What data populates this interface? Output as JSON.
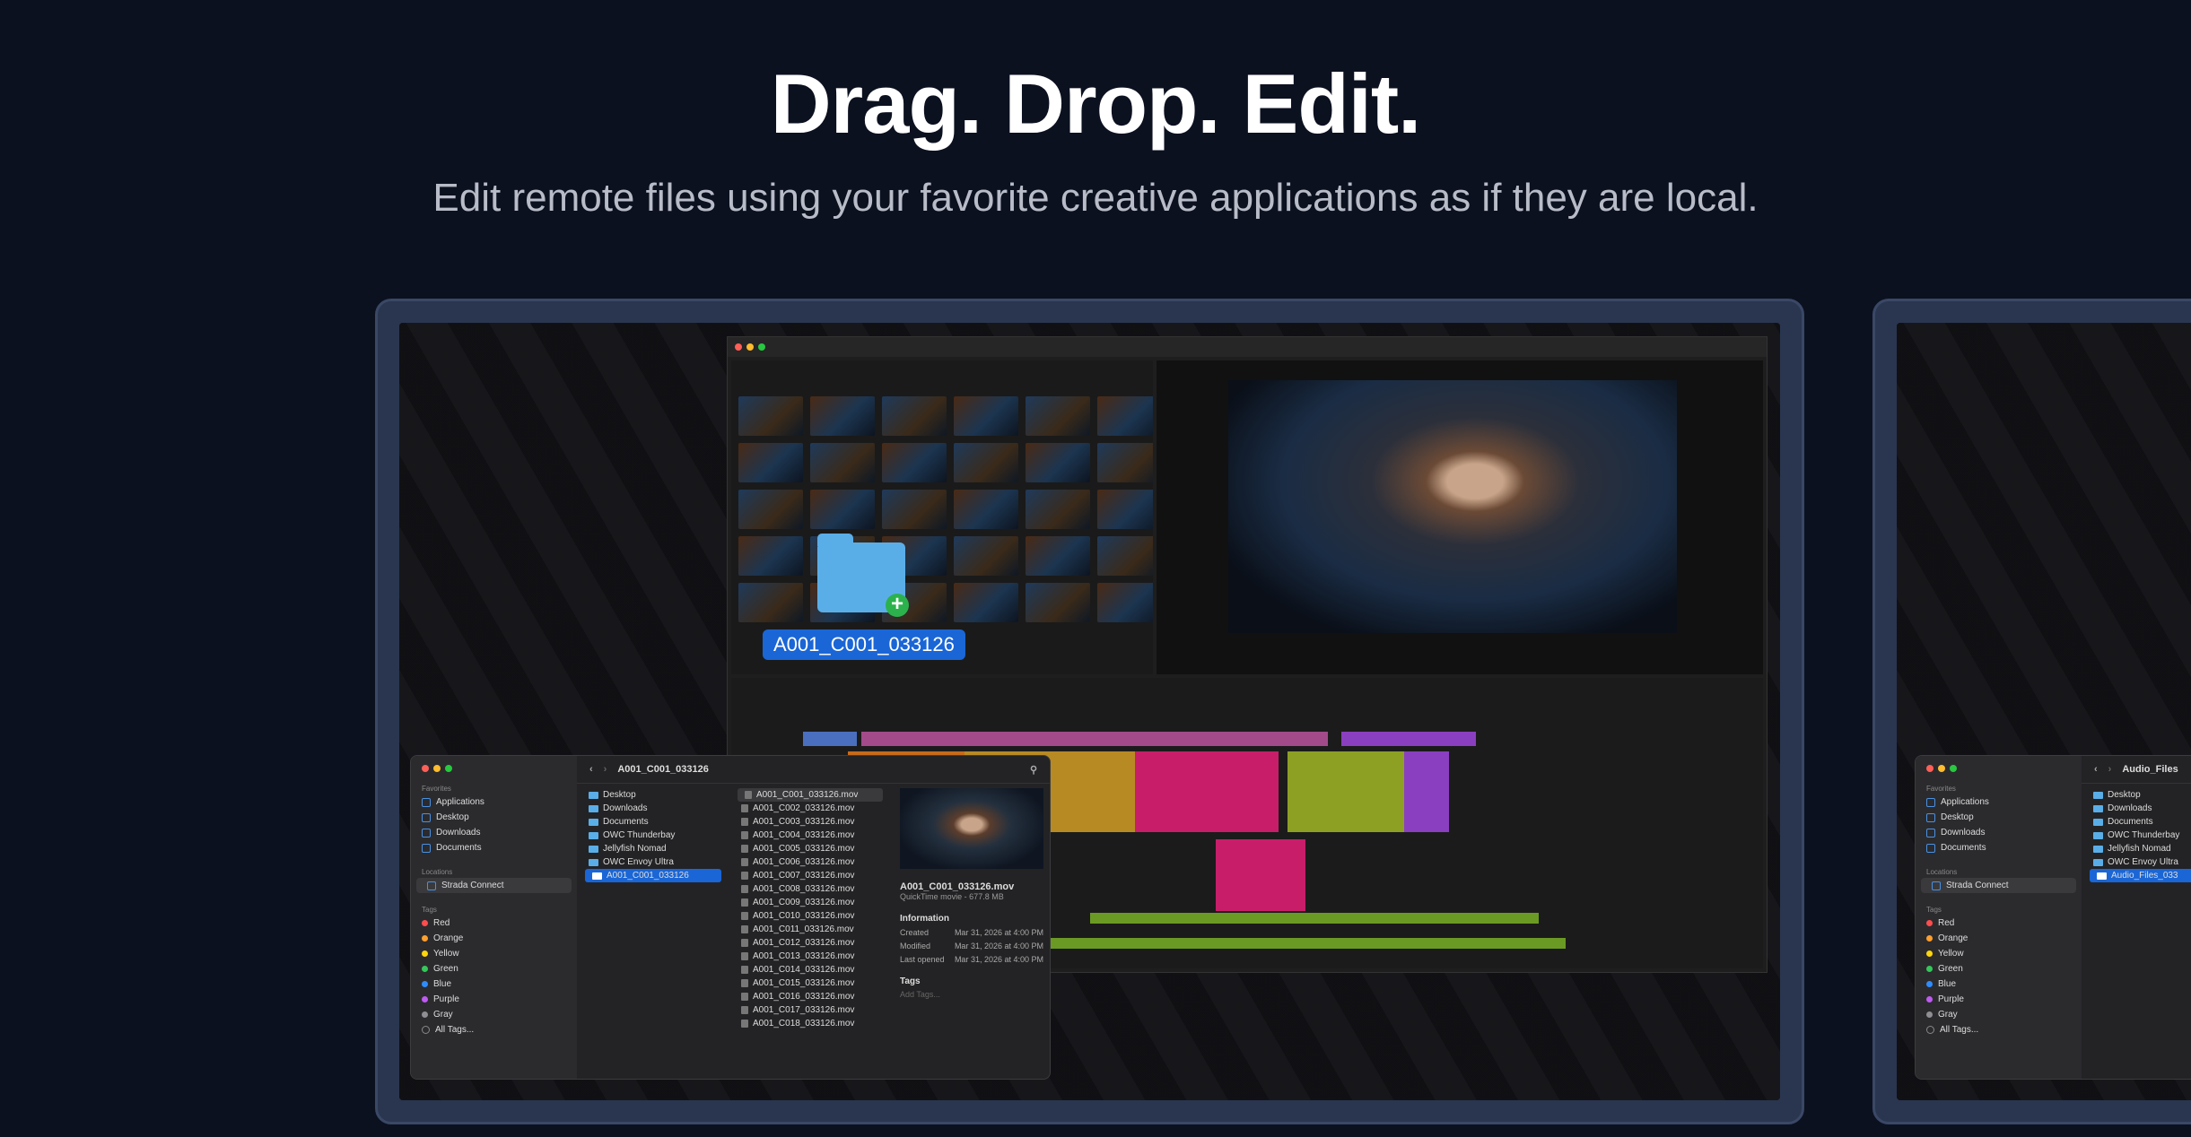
{
  "hero": {
    "title": "Drag. Drop. Edit.",
    "subtitle": "Edit remote files using your favorite creative applications as if they are local."
  },
  "drag": {
    "label": "A001_C001_033126",
    "plus": "+"
  },
  "finder": {
    "path_title": "A001_C001_033126",
    "sections": {
      "favorites": "Favorites",
      "locations": "Locations",
      "tags": "Tags"
    },
    "favorites": [
      "Applications",
      "Desktop",
      "Downloads",
      "Documents"
    ],
    "locations": [
      "Strada Connect"
    ],
    "tags": [
      {
        "label": "Red",
        "color": "#ff4d4d"
      },
      {
        "label": "Orange",
        "color": "#ff9f2e"
      },
      {
        "label": "Yellow",
        "color": "#ffd60a"
      },
      {
        "label": "Green",
        "color": "#34c759"
      },
      {
        "label": "Blue",
        "color": "#2f8cff"
      },
      {
        "label": "Purple",
        "color": "#bf5af2"
      },
      {
        "label": "Gray",
        "color": "#8e8e93"
      },
      {
        "label": "All Tags...",
        "color": ""
      }
    ],
    "folders": [
      "Desktop",
      "Downloads",
      "Documents",
      "OWC Thunderbay",
      "Jellyfish Nomad",
      "OWC Envoy Ultra",
      "A001_C001_033126"
    ],
    "files": [
      "A001_C001_033126.mov",
      "A001_C002_033126.mov",
      "A001_C003_033126.mov",
      "A001_C004_033126.mov",
      "A001_C005_033126.mov",
      "A001_C006_033126.mov",
      "A001_C007_033126.mov",
      "A001_C008_033126.mov",
      "A001_C009_033126.mov",
      "A001_C010_033126.mov",
      "A001_C011_033126.mov",
      "A001_C012_033126.mov",
      "A001_C013_033126.mov",
      "A001_C014_033126.mov",
      "A001_C015_033126.mov",
      "A001_C016_033126.mov",
      "A001_C017_033126.mov",
      "A001_C018_033126.mov"
    ],
    "preview": {
      "name": "A001_C001_033126.mov",
      "kind": "QuickTime movie - 677.8 MB",
      "info_title": "Information",
      "created_label": "Created",
      "created": "Mar 31, 2026 at 4:00 PM",
      "modified_label": "Modified",
      "modified": "Mar 31, 2026 at 4:00 PM",
      "opened_label": "Last opened",
      "opened": "Mar 31, 2026 at 4:00 PM",
      "tags_title": "Tags",
      "tags_placeholder": "Add Tags..."
    }
  },
  "finder2": {
    "path_title": "Audio_Files",
    "sections": {
      "favorites": "Favorites",
      "locations": "Locations",
      "tags": "Tags"
    },
    "favorites": [
      "Applications",
      "Desktop",
      "Downloads",
      "Documents"
    ],
    "locations": [
      "Strada Connect"
    ],
    "tags": [
      "Red",
      "Orange",
      "Yellow",
      "Green",
      "Blue",
      "Purple",
      "Gray",
      "All Tags..."
    ],
    "folders": [
      "Desktop",
      "Downloads",
      "Documents",
      "OWC Thunderbay",
      "Jellyfish Nomad",
      "OWC Envoy Ultra",
      "Audio_Files_033"
    ]
  },
  "colors": {
    "accent": "#1a66d6",
    "device_frame": "#2a3650",
    "background": "#0c1120"
  }
}
